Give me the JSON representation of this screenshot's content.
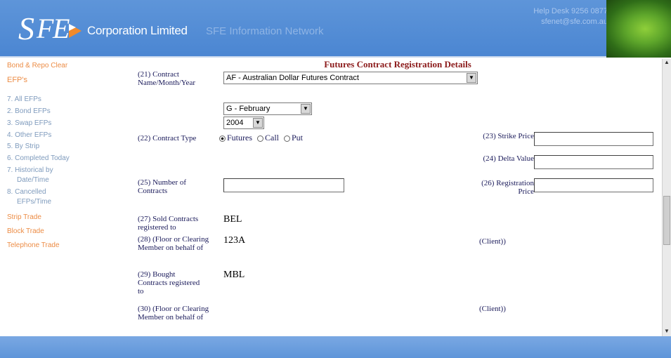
{
  "header": {
    "corp_title": "Corporation Limited",
    "network_title": "SFE Information Network",
    "help_desk_line1": "Help Desk 9256 0877",
    "help_desk_line2": "sfenet@sfe.com.au"
  },
  "sidebar": {
    "items": [
      "Bond & Repo Clear",
      "EFP's",
      "7. All EFPs",
      "2. Bond EFPs",
      "3. Swap EFPs",
      "4. Other EFPs",
      "5. By Strip",
      "6. Completed Today",
      "7. Historical by",
      "Date/Time",
      "8. Cancelled",
      "EFPs/Time",
      "Strip Trade",
      "Block Trade",
      "Telephone Trade"
    ]
  },
  "form": {
    "title": "Futures Contract Registration Details",
    "contract_label": "(21) Contract Name/Month/Year",
    "contract_value": "AF - Australian Dollar Futures Contract",
    "month_value": "G - February",
    "year_value": "2004",
    "contract_type_label": "(22) Contract Type",
    "contract_type_options": [
      "Futures",
      "Call",
      "Put"
    ],
    "contract_type_selected": "Futures",
    "strike_label": "(23) Strike Price",
    "delta_label": "(24) Delta Value",
    "number_label": "(25) Number of Contracts",
    "reg_price_label": "(26) Registration Price",
    "sold_label": "(27) Sold Contracts registered to",
    "sold_value": "BEL",
    "floor1_label": "(28) (Floor or Clearing Member on behalf of",
    "floor1_value": "123A",
    "client1_label": "(Client))",
    "bought_label": "(29) Bought Contracts registered to",
    "bought_value": "MBL",
    "floor2_label": "(30) (Floor or Clearing Member on behalf of",
    "client2_label": "(Client))"
  },
  "colors": {
    "header_blue": "#4b86d2",
    "nav_orange": "#ec8c45",
    "title_red": "#8b1a1a"
  }
}
